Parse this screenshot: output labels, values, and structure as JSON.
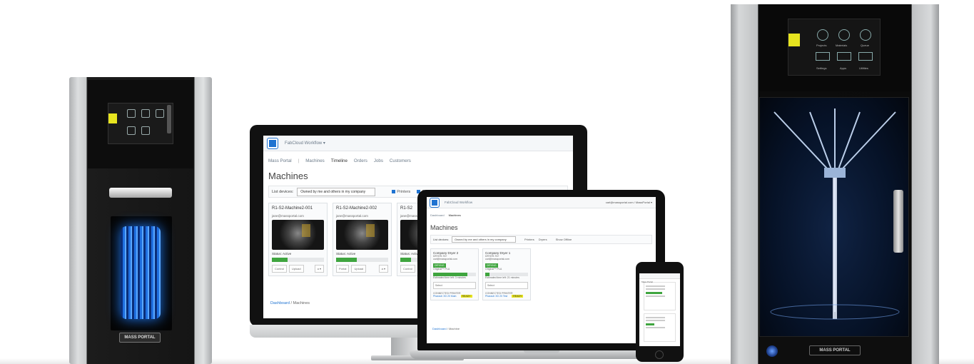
{
  "brand": {
    "name": "MASS PORTAL",
    "accent": "#1f73d1",
    "success": "#3fa53f",
    "highlight": "#e7e41f"
  },
  "desktop": {
    "app": "FabCloud Workflow ▾",
    "nav": [
      "Mass Portal",
      "|",
      "Machines",
      "Timeline",
      "Orders",
      "Jobs",
      "Customers"
    ],
    "title": "Machines",
    "filter_label": "List devices:",
    "filter_value": "Owned by me and others in my company",
    "checks": [
      "Printers",
      "O"
    ],
    "cards": [
      {
        "name": "R1-S2-Machine2-001",
        "email": "jane@massportal.com",
        "status": "Status: Active",
        "progress": 0.3,
        "btn1": "Control",
        "btn2": "Upload",
        "btn3": "a ▾"
      },
      {
        "name": "R1-S2-Machine2-002",
        "email": "jane@massportal.com",
        "status": "Status: Active",
        "progress": 0.4,
        "btn1": "Portal",
        "btn2": "Upload",
        "btn3": "a ▾"
      },
      {
        "name": "R1-S2",
        "email": "jane@massportal.com",
        "status": "Status: Active",
        "progress": 0.2,
        "btn1": "Control",
        "btn2": "",
        "btn3": ""
      }
    ],
    "breadcrumb": {
      "home": "Dashboard",
      "sep": "/",
      "current": "Machines"
    }
  },
  "laptop": {
    "app": "FabCloud Workflow",
    "user": "carl@massportal.com / MassPortal ▾",
    "nav": [
      "Dashboard",
      "Machines"
    ],
    "title": "Machines",
    "filter_label": "List devices:",
    "filter_value": "Owned by me and others in my company",
    "checks": [
      "Printers",
      "Dryers",
      "Show Offline"
    ],
    "cards": [
      {
        "name": "Company Dryer 2",
        "id": "DRYER-T6+",
        "email": "carl@massportal.com",
        "badge": "DRYING",
        "material": "Original™ PLA",
        "progress": 0.8,
        "remaining": "Estimated time left: 3 minutes",
        "select": "Select",
        "connected": "CONNECTED PRINTER",
        "printer": "Pharaoh XD 20 Main",
        "tag": "READY"
      },
      {
        "name": "Company Dryer 1",
        "id": "DRYER-T6+",
        "email": "carl@massportal.com",
        "badge": "DRYING",
        "material": "Original™ PLA",
        "progress": 0.1,
        "remaining": "Estimated time left: 21 minutes",
        "select": "Select",
        "connected": "CONNECTED PRINTER",
        "printer": "Pharaoh XD 20 Test",
        "tag": "READY"
      }
    ],
    "breadcrumb": {
      "home": "Dashboard",
      "sep": "/",
      "current": "Machine"
    }
  },
  "phone": {
    "title": "Mass Portal"
  },
  "left_printer": {
    "logo": "MASS PORTAL"
  },
  "right_printer": {
    "logo": "MASS PORTAL",
    "screen_items": [
      "Projects",
      "Materials",
      "Queue",
      "Settings",
      "Apps",
      "Utilities"
    ]
  }
}
